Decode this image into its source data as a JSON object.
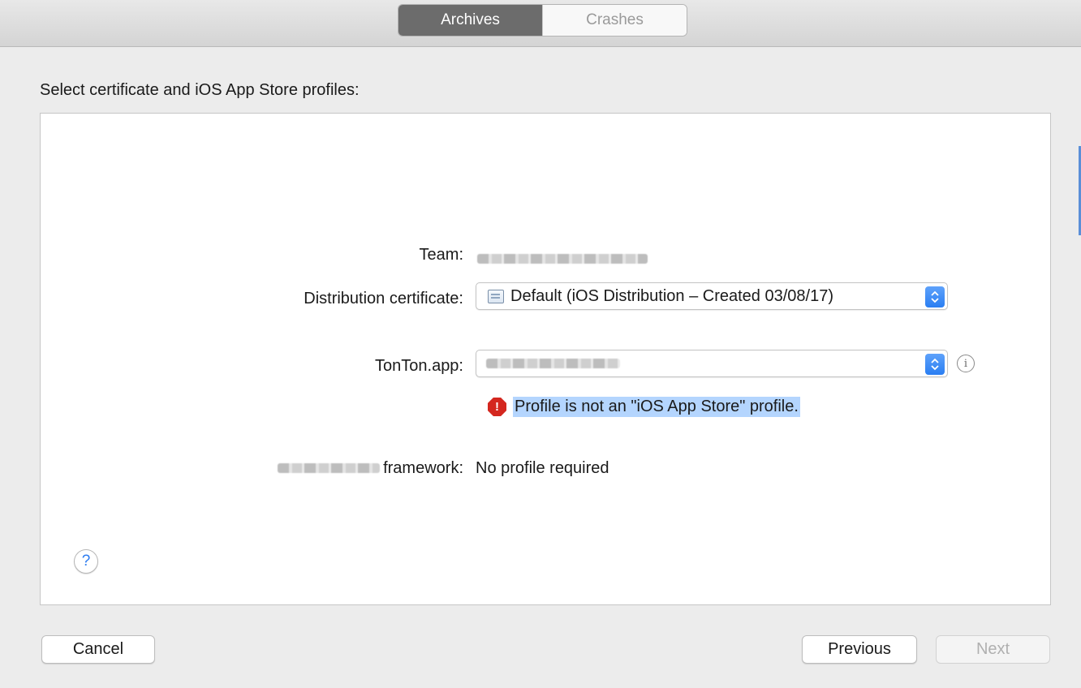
{
  "toolbar": {
    "tabs": [
      {
        "label": "Archives",
        "active": true
      },
      {
        "label": "Crashes",
        "active": false
      }
    ]
  },
  "prompt": "Select certificate and iOS App Store profiles:",
  "form": {
    "team": {
      "label": "Team:",
      "value_redacted": true
    },
    "distribution_certificate": {
      "label": "Distribution certificate:",
      "selected": "Default (iOS Distribution – Created 03/08/17)",
      "icon": "certificate-icon"
    },
    "app_profile": {
      "label": "TonTon.app:",
      "selected_redacted": true,
      "info_icon": "info-icon"
    },
    "error": {
      "icon": "error-octagon-icon",
      "message": "Profile is not an \"iOS App Store\" profile.",
      "color": "#d4271f"
    },
    "framework": {
      "label": "framework:",
      "value": "No profile required"
    }
  },
  "help": {
    "label": "?"
  },
  "buttons": {
    "cancel": "Cancel",
    "previous": "Previous",
    "next": "Next"
  },
  "colors": {
    "accent": "#2a7ef2",
    "selection": "#b4d5fe",
    "segment_active": "#6c6c6c"
  }
}
